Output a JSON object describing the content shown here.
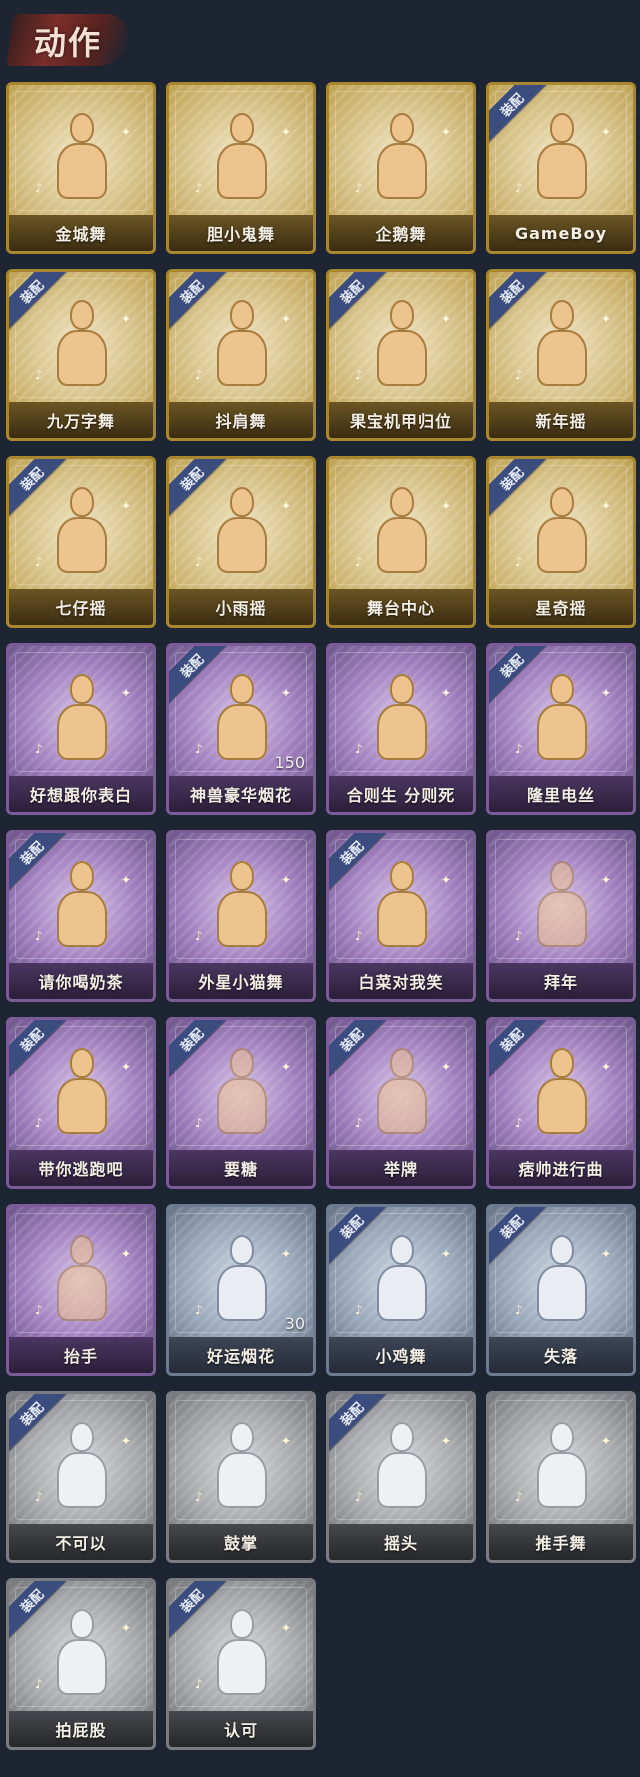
{
  "header": {
    "title": "动作"
  },
  "equip_label": "装配",
  "cards": [
    {
      "label": "金城舞",
      "tier": "gold",
      "equipped": false
    },
    {
      "label": "胆小鬼舞",
      "tier": "gold",
      "equipped": false
    },
    {
      "label": "企鹅舞",
      "tier": "gold",
      "equipped": false
    },
    {
      "label": "GameBoy",
      "tier": "gold",
      "equipped": true
    },
    {
      "label": "九万字舞",
      "tier": "gold",
      "equipped": true
    },
    {
      "label": "抖肩舞",
      "tier": "gold",
      "equipped": true
    },
    {
      "label": "果宝机甲归位",
      "tier": "gold",
      "equipped": true
    },
    {
      "label": "新年摇",
      "tier": "gold",
      "equipped": true
    },
    {
      "label": "七仔摇",
      "tier": "gold",
      "equipped": true
    },
    {
      "label": "小雨摇",
      "tier": "gold",
      "equipped": true
    },
    {
      "label": "舞台中心",
      "tier": "gold",
      "equipped": false
    },
    {
      "label": "星奇摇",
      "tier": "gold",
      "equipped": true
    },
    {
      "label": "好想跟你表白",
      "tier": "purple",
      "equipped": false
    },
    {
      "label": "神兽豪华烟花",
      "tier": "purple",
      "equipped": true,
      "qty": "150"
    },
    {
      "label": "合则生 分则死",
      "tier": "purple",
      "equipped": false
    },
    {
      "label": "隆里电丝",
      "tier": "purple",
      "equipped": true
    },
    {
      "label": "请你喝奶茶",
      "tier": "purple",
      "equipped": true
    },
    {
      "label": "外星小猫舞",
      "tier": "purple",
      "equipped": false
    },
    {
      "label": "白菜对我笑",
      "tier": "purple",
      "equipped": true
    },
    {
      "label": "拜年",
      "tier": "purple",
      "equipped": false,
      "dim": true
    },
    {
      "label": "带你逃跑吧",
      "tier": "purple",
      "equipped": true
    },
    {
      "label": "要糖",
      "tier": "purple",
      "equipped": true,
      "dim": true
    },
    {
      "label": "举牌",
      "tier": "purple",
      "equipped": true,
      "dim": true
    },
    {
      "label": "痞帅进行曲",
      "tier": "purple",
      "equipped": true
    },
    {
      "label": "抬手",
      "tier": "purple",
      "equipped": false,
      "dim": true
    },
    {
      "label": "好运烟花",
      "tier": "blue",
      "equipped": false,
      "qty": "30"
    },
    {
      "label": "小鸡舞",
      "tier": "blue",
      "equipped": true
    },
    {
      "label": "失落",
      "tier": "blue",
      "equipped": true
    },
    {
      "label": "不可以",
      "tier": "gray",
      "equipped": true
    },
    {
      "label": "鼓掌",
      "tier": "gray",
      "equipped": false
    },
    {
      "label": "摇头",
      "tier": "gray",
      "equipped": true
    },
    {
      "label": "推手舞",
      "tier": "gray",
      "equipped": false
    },
    {
      "label": "拍屁股",
      "tier": "gray",
      "equipped": true
    },
    {
      "label": "认可",
      "tier": "gray",
      "equipped": true
    }
  ]
}
